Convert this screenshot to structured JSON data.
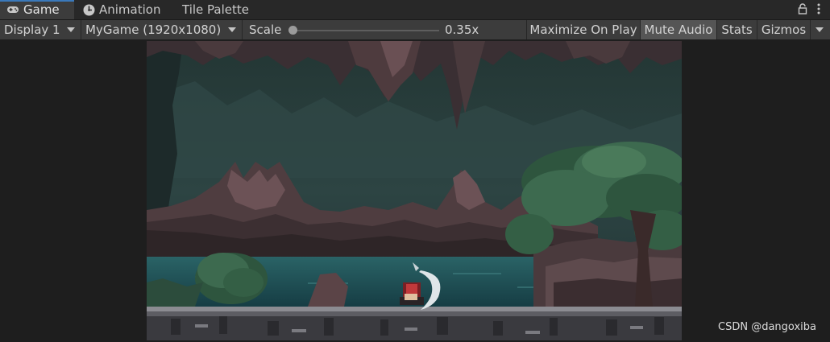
{
  "tabs": [
    {
      "label": "Game",
      "icon": "gamepad-icon",
      "active": true
    },
    {
      "label": "Animation",
      "icon": "animation-icon",
      "active": false
    },
    {
      "label": "Tile Palette",
      "icon": null,
      "active": false
    }
  ],
  "toolbar": {
    "display_label": "Display 1",
    "resolution_label": "MyGame (1920x1080)",
    "scale_label": "Scale",
    "scale_value": "0.35x",
    "maximize_label": "Maximize On Play",
    "mute_label": "Mute Audio",
    "stats_label": "Stats",
    "gizmos_label": "Gizmos"
  },
  "scale_level": 0.0,
  "mute_audio_active": true,
  "watermark": "CSDN @dangoxiba",
  "colors": {
    "tab_accent": "#3a79bb",
    "editor_background": "#1e1e1e",
    "toolbar_background": "#3c3c3c",
    "toggle_active_background": "#555555",
    "cave_background": "#2a3c3b",
    "water": "#1f4f55",
    "foliage": "#3d6a4f",
    "rock": "#5b4447"
  }
}
